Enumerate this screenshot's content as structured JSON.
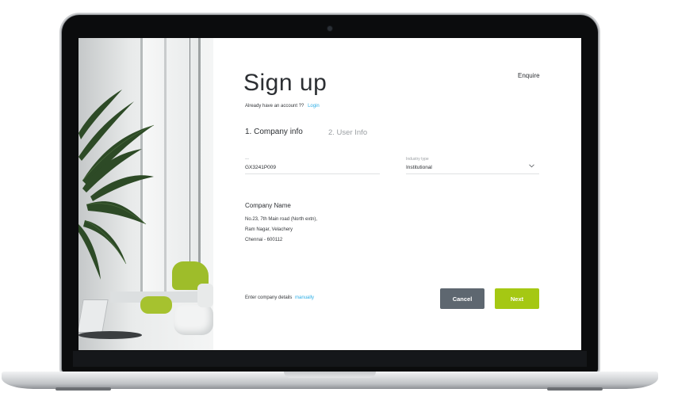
{
  "form": {
    "title": "Sign up",
    "enquire": "Enquire",
    "account_prompt": "Already have an account ??",
    "login": "Login",
    "steps": [
      {
        "label": "1. Company info"
      },
      {
        "label": "2. User Info"
      }
    ],
    "gst": {
      "label": "---",
      "value": "GX3241P009"
    },
    "industry": {
      "label": "Industry type",
      "value": "Institutional"
    },
    "company_name": "Company Name",
    "address": [
      "No.23, 7th Main road (North extn),",
      "Ram Nagar, Velachery",
      "Chennai - 600112"
    ],
    "manual_prompt": "Enter company details",
    "manual_link": "manually",
    "cancel": "Cancel",
    "next": "Next"
  },
  "colors": {
    "accent_link": "#2eaee6",
    "next_button": "#a5c813",
    "cancel_button": "#5e6770"
  },
  "icons": {
    "industry_dropdown": "chevron-down-icon",
    "camera": "camera-icon"
  }
}
